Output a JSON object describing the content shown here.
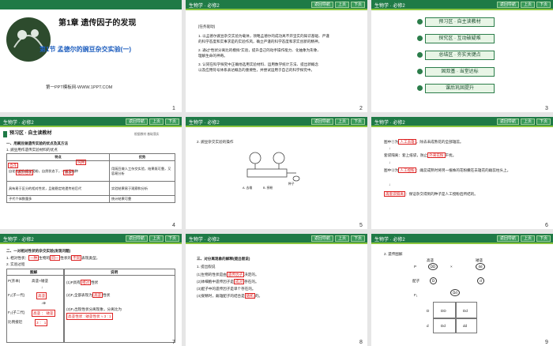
{
  "common": {
    "subject": "生物学 · 必修2",
    "btn_back": "返回导航",
    "btn_prev": "上页",
    "btn_next": "下页"
  },
  "slide1": {
    "number": "1",
    "chapter": "第1章  遗传因子的发现",
    "section": "第1节  孟德尔的豌豆杂交实验(一)",
    "footer": "第一PPT模板网-WWW.1PPT.COM"
  },
  "slide2": {
    "number": "2",
    "heading": "[任务驱动]",
    "lines": [
      "1. 以孟德尔豌豆杂交实验为载体，领略孟德尔的成功离不开坚实的知识基础、严谨",
      "   的科学态度和实事求是的实验作风，确立严谨的科学态度和求实创新的精神。",
      "2. 通过“性状分离比的模拟”实验，提升自己的动手操作能力、化抽象为形象、",
      "   理解生命的神奇。",
      "3. 认同在科学探究中正确地选用实验材料、运用数学统计方法、提出新概念",
      "   以及应用符号体系表达概念的重要性，并尝试运用于自己的科学探究中。"
    ]
  },
  "slide3": {
    "number": "3",
    "menu": [
      "预习区 · 自主读教材",
      "探究区 · 互动破疑难",
      "总结区 · 夯实关键点",
      "固双基 · 当堂达标",
      "课后巩固提升"
    ]
  },
  "slide4": {
    "number": "4",
    "section": "预习区 · 自主读教材",
    "tag": "根据教材  基础落实",
    "title1": "一、用豌豆做遗传实验的优点及其方法",
    "title2": "1. 豌豆用作遗传实验材料的优点",
    "col_a": "特点",
    "col_b": "优势",
    "rows": [
      [
        "自花传粉和闭花受粉，自然状态下，一般是纯种",
        "用豌豆做人工杂交实验，结果既可靠，又容易分析"
      ],
      [
        "具有易于区分的相对性状，且能稳定地遗传给后代",
        "实验结果易于观察和分析"
      ],
      [
        "子代个体数量多",
        "统计结果可靠"
      ]
    ],
    "fill1": "自花",
    "fill2": "纯种",
    "fill3": "相对性状",
    "fill4": "稳定"
  },
  "slide5": {
    "number": "5",
    "title": "2. 豌豆杂交实验的操作",
    "label_a": "A. 去雄",
    "label_b": "B. 授粉",
    "label_c": "种子"
  },
  "slide6": {
    "number": "6",
    "line1a": "图中①为",
    "line1b": "人工去雄",
    "line1c": "，除去未成熟花的全部雄蕊。",
    "line2a": "套袋隔离：套上纸袋，防止",
    "line2b": "外来花粉",
    "line2c": "干扰。",
    "line3a": "图中②为",
    "line3b": "人工授粉",
    "line3c": "：雌蕊成熟时将另一植株的花粉撒在去雄花的雌蕊柱头上。",
    "line4a": "再套袋隔离",
    "line4b": "：保证杂交得到的种子是人工授粉后所结的。"
  },
  "slide7": {
    "number": "7",
    "title": "二、一对相对性状的杂交实验(发现问题)",
    "q1a": "1. 相对性状：",
    "q1b": "一种",
    "q1c": "生物的",
    "q1d": "同一",
    "q1e": "性状的",
    "q1f": "不同",
    "q1g": "表现类型。",
    "q2": "2. 实验过程",
    "col_a": "图解",
    "col_b": "说明",
    "p": "P(亲本)",
    "p_cross": "高茎×矮茎",
    "f1": "F₁(子一代)",
    "f1_val": "高茎",
    "f2": "F₂(子二代)",
    "f2_val": "高茎 ： 矮茎",
    "ratio": "比例接近",
    "ratio_val": "3 ： 1",
    "note1a": "(1)P具有",
    "note1b": "相对",
    "note1c": "性状",
    "note2a": "(2)F₁全部表现为",
    "note2b": "高茎",
    "note2c": "性状",
    "note3": "(3)F₂出现性状分离现象，分离比为",
    "note3b": "高茎性状 : 矮茎性状 ≈ 3 : 1"
  },
  "slide8": {
    "number": "8",
    "title": "三、对分离现象的解释(提出假说)",
    "sub": "1. 提出假说",
    "l1a": "(1)生物的性状是由",
    "l1b": "遗传因子",
    "l1c": "决定的。",
    "l2a": "(2)体细胞中遗传因子是",
    "l2b": "成对",
    "l2c": "存在的。",
    "l3": "(3)配子中的遗传因子是单个存在的。",
    "l4a": "(4)受精时，雌雄配子的结合是",
    "l4b": "随机",
    "l4c": "的。"
  },
  "slide9": {
    "number": "9",
    "title": "2. 遗传图解",
    "p": "P",
    "tall": "高茎",
    "short": "矮茎",
    "dd1": "DD",
    "dd2": "dd",
    "gamete": "配子",
    "d_big": "D",
    "d_small": "d",
    "f1": "F₁",
    "f1_g": "Dd",
    "grid": [
      "D",
      "d",
      "DD",
      "Dd",
      "Dd",
      "dd"
    ]
  }
}
